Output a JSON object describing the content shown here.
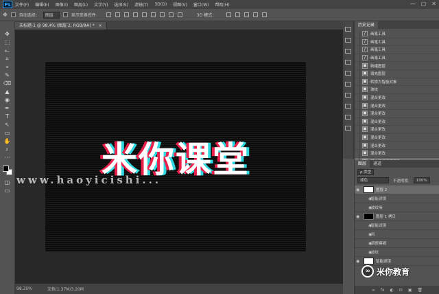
{
  "app": {
    "logo": "Ps"
  },
  "menu": [
    "文件(F)",
    "编辑(E)",
    "图像(I)",
    "图层(L)",
    "文字(Y)",
    "选择(S)",
    "滤镜(T)",
    "3D(D)",
    "视图(V)",
    "窗口(W)",
    "帮助(H)"
  ],
  "window_controls": [
    "—",
    "▢",
    "✕"
  ],
  "options": {
    "auto_select_label": "自动选择：",
    "auto_select_value": "图层",
    "show_transform_label": "显示变换控件",
    "mode_3d": "3D 模式："
  },
  "document_tab": {
    "label": "未标题-1 @ 98.4% (图层 2, RGB/8#) *",
    "close": "×"
  },
  "canvas": {
    "main_text": "米你课堂",
    "watermark": "www.haoyicishi..."
  },
  "status": {
    "zoom": "98.35%",
    "doc_size": "文档:1.37M/3.20M"
  },
  "tools": [
    "✥",
    "⬚",
    "ᓚ",
    "⌗",
    "⌖",
    "✎",
    "⌫",
    "▲",
    "◉",
    "✒",
    "T",
    "↖",
    "▭",
    "✋",
    "⌕",
    "···"
  ],
  "history_panel": {
    "tabs": [
      "历史记录"
    ],
    "items": [
      {
        "icon": "/",
        "label": "画笔工具"
      },
      {
        "icon": "/",
        "label": "画笔工具"
      },
      {
        "icon": "/",
        "label": "画笔工具"
      },
      {
        "icon": "/",
        "label": "画笔工具"
      },
      {
        "icon": "▣",
        "label": "新建图层"
      },
      {
        "icon": "▣",
        "label": "填充图层"
      },
      {
        "icon": "▣",
        "label": "转换为智能对象"
      },
      {
        "icon": "▣",
        "label": "波纹"
      },
      {
        "icon": "▣",
        "label": "混合更改"
      },
      {
        "icon": "▣",
        "label": "混合更改"
      },
      {
        "icon": "▣",
        "label": "混合更改"
      },
      {
        "icon": "▣",
        "label": "混合更改"
      },
      {
        "icon": "▣",
        "label": "混合更改"
      },
      {
        "icon": "▣",
        "label": "混合更改"
      },
      {
        "icon": "▣",
        "label": "混合更改"
      },
      {
        "icon": "▣",
        "label": "混合更改"
      },
      {
        "icon": "▣",
        "label": "图体不透明度更改"
      }
    ],
    "selected_index": 16,
    "foot_icons": [
      "⎘",
      "◉",
      "🗑"
    ]
  },
  "layers_panel": {
    "tabs": [
      "图层",
      "通道"
    ],
    "kind_label": "ρ 类型",
    "blend_mode": "滤色",
    "opacity_label": "不透明度:",
    "opacity_value": "100%",
    "fill_label": "填充:",
    "fill_value": "100%",
    "rows": [
      {
        "type": "layer",
        "name": "图层 2",
        "thumb": "light",
        "selected": true
      },
      {
        "type": "fx",
        "name": "智能滤镜"
      },
      {
        "type": "fx",
        "name": "波纹噪"
      },
      {
        "type": "layer",
        "name": "图层 1 拷贝",
        "thumb": "dark",
        "selected": false
      },
      {
        "type": "fx",
        "name": "智能滤镜"
      },
      {
        "type": "fx",
        "name": "风"
      },
      {
        "type": "fx",
        "name": "调整模糊"
      },
      {
        "type": "fx",
        "name": "波纹"
      },
      {
        "type": "layer",
        "name": "智能滤镜",
        "thumb": "light",
        "selected": false
      }
    ],
    "foot_icons": [
      "∞",
      "fx",
      "◐",
      "⊡",
      "▣",
      "🗑"
    ]
  },
  "brand": {
    "logo": "∞",
    "name": "米你教育"
  }
}
